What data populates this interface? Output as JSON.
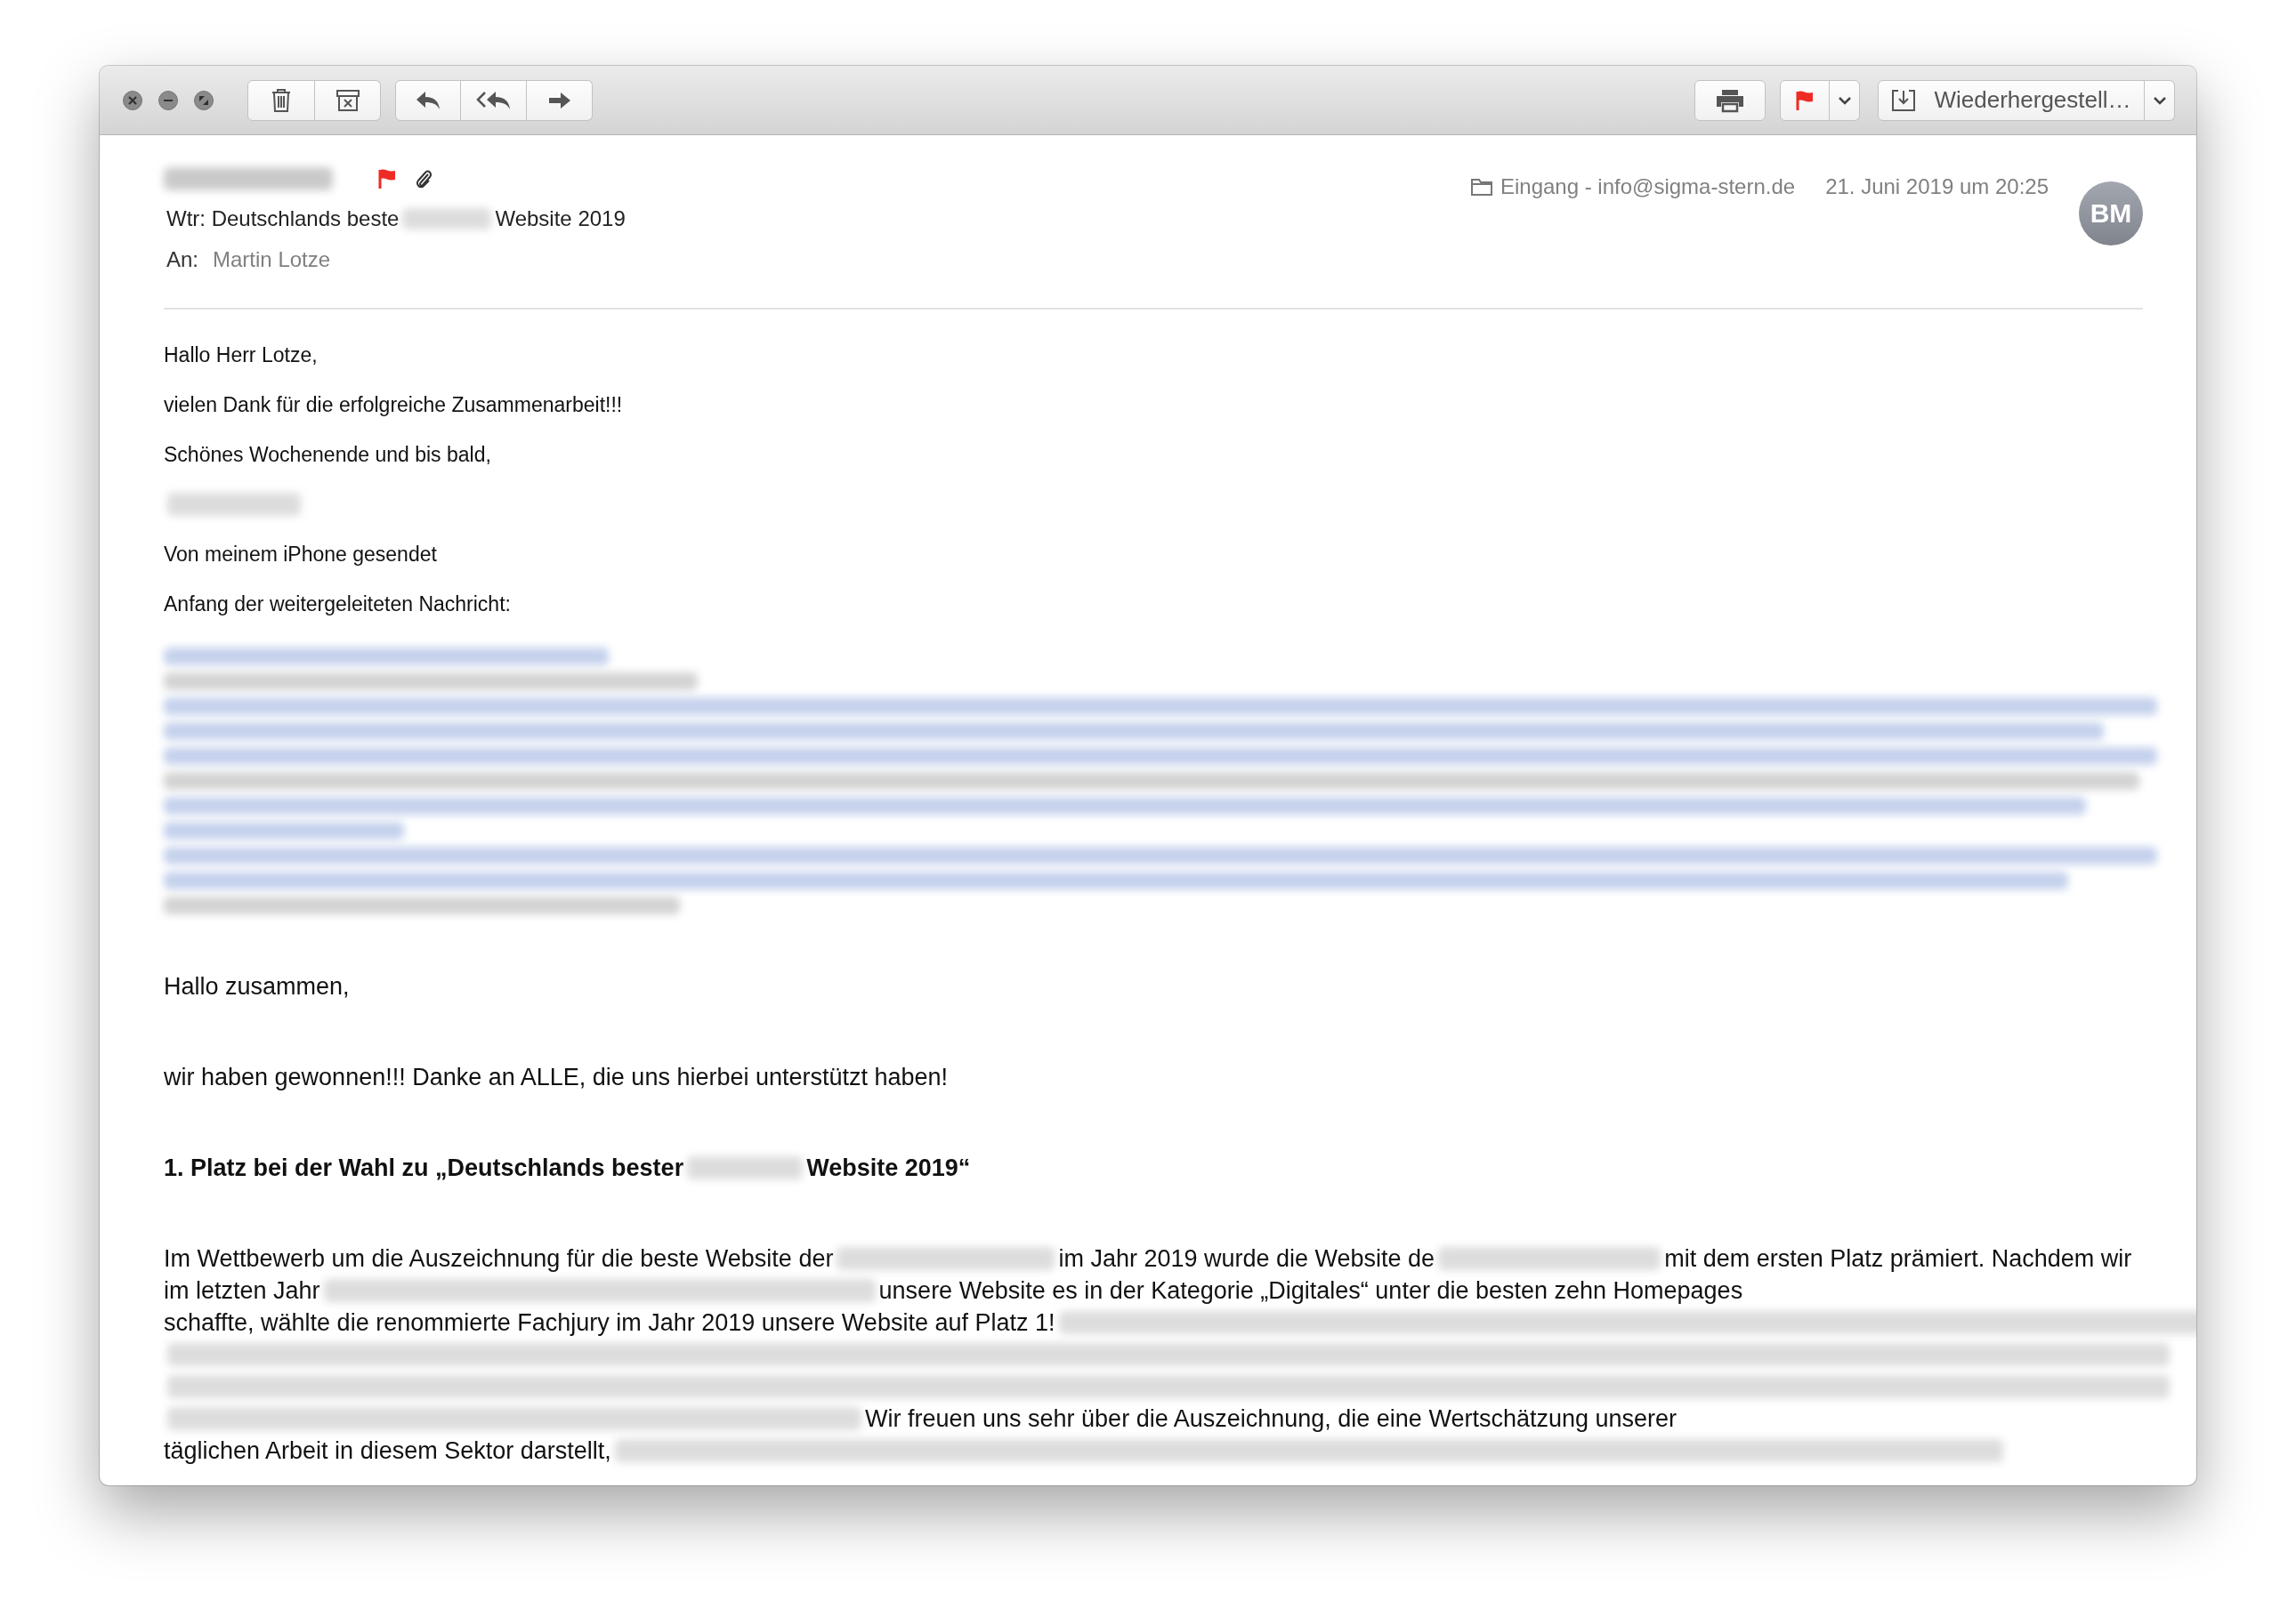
{
  "toolbar": {
    "mailbox_button": {
      "label": "Wiederhergestell…"
    },
    "flag_button": {
      "flagged": true
    }
  },
  "header": {
    "flagged": true,
    "attachment": true,
    "subject": [
      {
        "kind": "text",
        "text": "Wtr: Deutschlands beste"
      },
      {
        "kind": "redacted"
      },
      {
        "kind": "text",
        "text": "Website 2019"
      }
    ],
    "to_label": "An:",
    "to": "Martin Lotze",
    "mailbox": "Eingang - info@sigma-stern.de",
    "date": "21. Juni 2019 um 20:25",
    "avatar": "BM"
  },
  "intro": [
    [
      {
        "kind": "text",
        "text": "Hallo Herr Lotze,"
      }
    ],
    [
      {
        "kind": "text",
        "text": "vielen Dank für die erfolgreiche Zusammenarbeit!!!"
      }
    ],
    [
      {
        "kind": "text",
        "text": "Schönes Wochenende und bis bald,"
      }
    ],
    [
      {
        "kind": "redacted"
      }
    ],
    [
      {
        "kind": "text",
        "text": "Von meinem iPhone gesendet"
      }
    ],
    [
      {
        "kind": "text",
        "text": "Anfang der weitergeleiteten Nachricht:"
      }
    ]
  ],
  "letter": [
    {
      "kind": "para",
      "lines": [
        [
          {
            "kind": "text",
            "text": "Hallo zusammen,"
          }
        ]
      ]
    },
    {
      "kind": "para",
      "lines": [
        [
          {
            "kind": "text",
            "text": "wir haben gewonnen!!! Danke an ALLE, die uns hierbei unterstützt haben!"
          }
        ]
      ]
    },
    {
      "kind": "heading",
      "lines": [
        [
          {
            "kind": "text",
            "text": "1. Platz bei der Wahl zu „Deutschlands bester"
          },
          {
            "kind": "redacted"
          },
          {
            "kind": "text",
            "text": "Website 2019“"
          }
        ]
      ]
    },
    {
      "kind": "para",
      "lines": [
        [
          {
            "kind": "text",
            "text": "Im Wettbewerb um die Auszeichnung für die beste Website der"
          },
          {
            "kind": "redacted"
          },
          {
            "kind": "text",
            "text": "im Jahr 2019 wurde die Website de"
          },
          {
            "kind": "redacted"
          },
          {
            "kind": "text",
            "text": "mit dem ersten Platz prämiert. Nachdem wir"
          }
        ],
        [
          {
            "kind": "text",
            "text": "im letzten Jahr"
          },
          {
            "kind": "redacted"
          },
          {
            "kind": "text",
            "text": "unsere Website es in der Kategorie „Digitales“ unter die besten zehn Homepages"
          }
        ],
        [
          {
            "kind": "text",
            "text": "schaffte, wählte die renommierte Fachjury im Jahr 2019 unsere Website auf Platz 1!"
          },
          {
            "kind": "redacted"
          }
        ],
        [
          {
            "kind": "redacted"
          }
        ],
        [
          {
            "kind": "redacted"
          }
        ],
        [
          {
            "kind": "redacted"
          },
          {
            "kind": "text",
            "text": "Wir freuen uns sehr über die Auszeichnung, die eine Wertschätzung unserer"
          }
        ],
        [
          {
            "kind": "text",
            "text": "täglichen Arbeit in diesem Sektor darstellt,"
          },
          {
            "kind": "redacted"
          }
        ]
      ]
    }
  ]
}
